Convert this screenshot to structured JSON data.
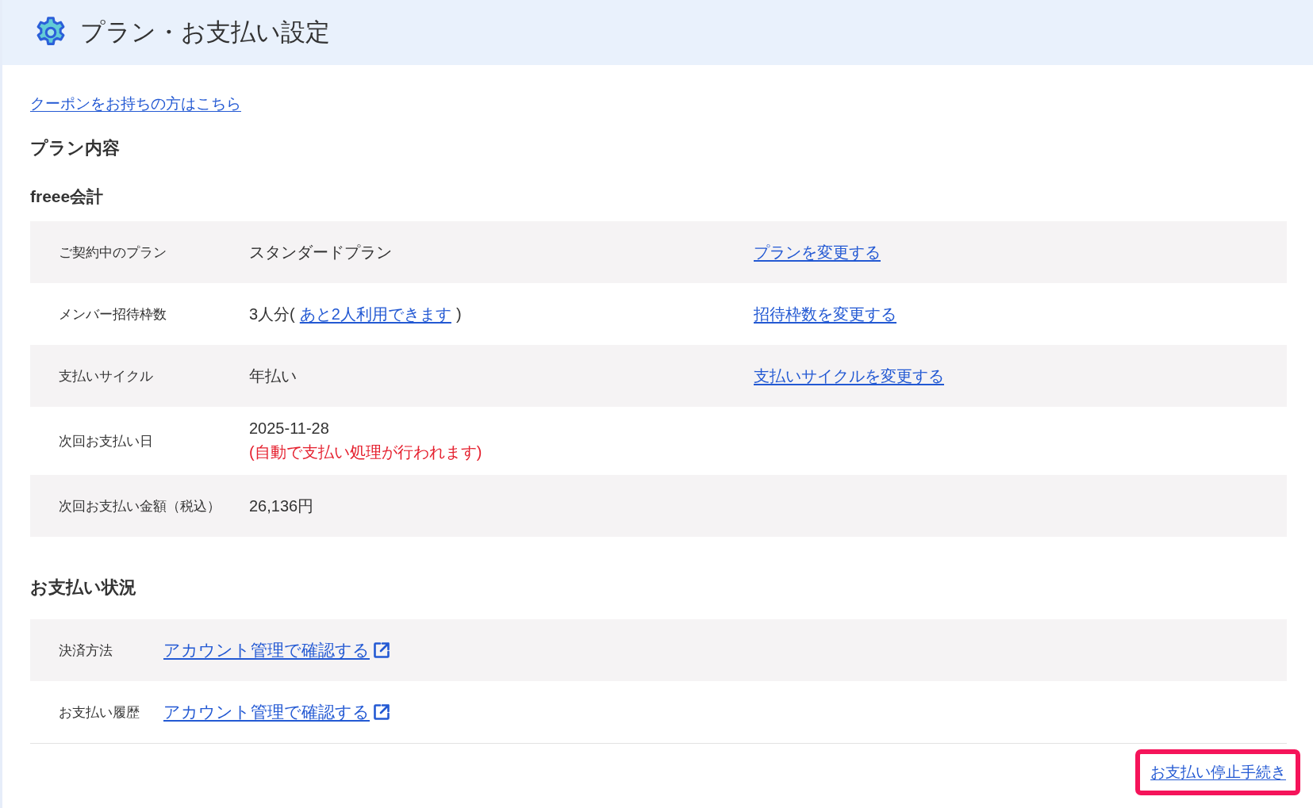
{
  "header": {
    "title": "プラン・お支払い設定"
  },
  "coupon_link": "クーポンをお持ちの方はこちら",
  "plan_section": {
    "heading": "プラン内容",
    "product": "freee会計",
    "rows": [
      {
        "label": "ご契約中のプラン",
        "kind": "text",
        "value": "スタンダードプラン",
        "action": "プランを変更する"
      },
      {
        "label": "メンバー招待枠数",
        "kind": "value_with_link",
        "value": "3人分(",
        "link": "あと2人利用できます",
        "value_end": ")",
        "action": "招待枠数を変更する"
      },
      {
        "label": "支払いサイクル",
        "kind": "text",
        "value": "年払い",
        "action": "支払いサイクルを変更する"
      },
      {
        "label": "次回お支払い日",
        "kind": "date_with_note",
        "value": "2025-11-28",
        "note": "(自動で支払い処理が行われます)"
      },
      {
        "label": "次回お支払い金額（税込）",
        "kind": "text",
        "value": "26,136円"
      }
    ]
  },
  "payment_section": {
    "heading": "お支払い状況",
    "rows": [
      {
        "label": "決済方法",
        "link": "アカウント管理で確認する"
      },
      {
        "label": "お支払い履歴",
        "link": "アカウント管理で確認する"
      }
    ]
  },
  "stop_link": {
    "label": "お支払い停止手続き",
    "highlighted": true
  }
}
